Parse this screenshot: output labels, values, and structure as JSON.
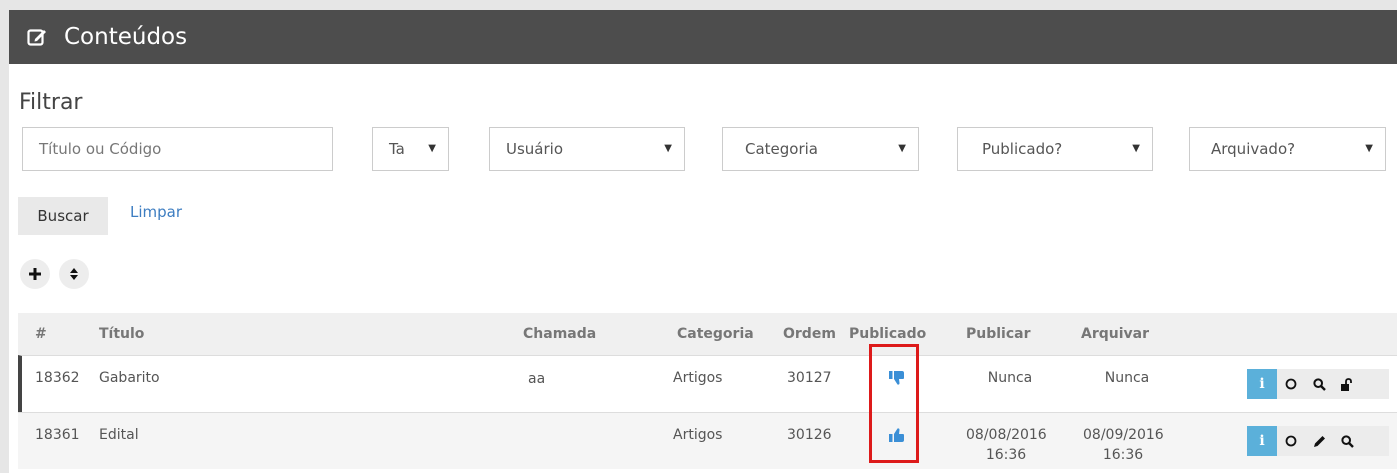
{
  "header": {
    "title": "Conteúdos",
    "icon": "edit-icon"
  },
  "filter": {
    "heading": "Filtrar",
    "search_placeholder": "Título ou Código",
    "selects": {
      "tags": "Ta",
      "user": "Usuário",
      "category": "Categoria",
      "published": "Publicado?",
      "archived": "Arquivado?"
    },
    "search_button": "Buscar",
    "clear_link": "Limpar"
  },
  "toolbar": {
    "add_icon": "plus-icon",
    "sort_icon": "sort-icon"
  },
  "table": {
    "columns": [
      "#",
      "Título",
      "Chamada",
      "Categoria",
      "Ordem",
      "Publicado",
      "Publicar",
      "Arquivar"
    ],
    "rows": [
      {
        "id": "18362",
        "title": "Gabarito",
        "call": "aa",
        "category": "Artigos",
        "order": "30127",
        "published": "thumbs-down-icon",
        "publish_date": "Nunca",
        "publish_time": "",
        "archive_date": "Nunca",
        "archive_time": ""
      },
      {
        "id": "18361",
        "title": "Edital",
        "call": "",
        "category": "Artigos",
        "order": "30126",
        "published": "thumbs-up-icon",
        "publish_date": "08/08/2016",
        "publish_time": "16:36",
        "archive_date": "08/09/2016",
        "archive_time": "16:36"
      }
    ]
  },
  "colors": {
    "header_bg": "#4d4d4d",
    "accent_blue": "#5bb0da",
    "link": "#3d7dc1",
    "highlight_red": "#dd1a1a"
  }
}
